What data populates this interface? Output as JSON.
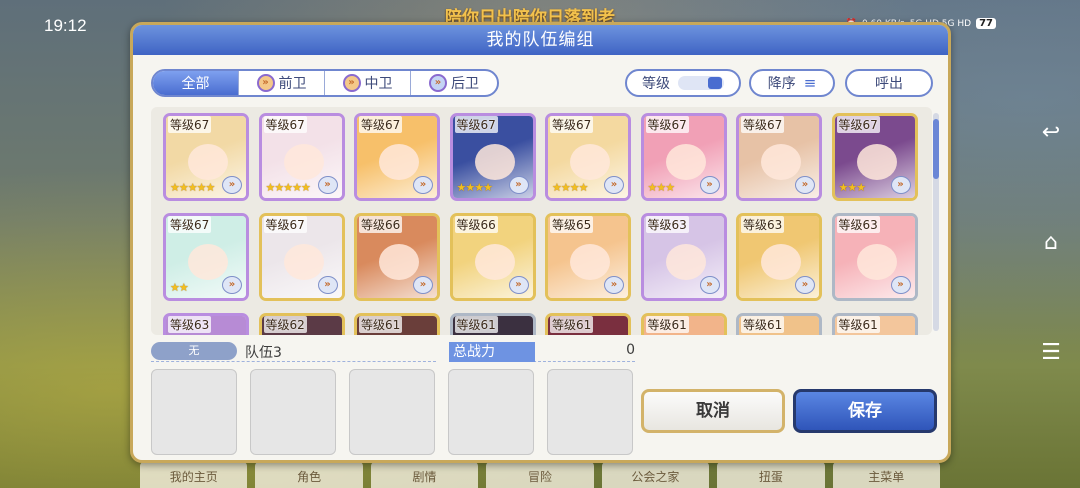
{
  "status": {
    "time": "19:12",
    "marquee": "陪你日出陪你日落到老",
    "net": "0.60 KB/s",
    "signal": "5G HD  5G HD",
    "battery": "77"
  },
  "dialog": {
    "title": "我的队伍编组"
  },
  "tabs": [
    {
      "label": "全部"
    },
    {
      "label": "前卫"
    },
    {
      "label": "中卫"
    },
    {
      "label": "后卫"
    }
  ],
  "controls": {
    "level_label": "等级",
    "sort_label": "降序",
    "call_label": "呼出"
  },
  "characters": [
    {
      "level": "等级67",
      "stars": 5,
      "frame": "purple",
      "color": "#f2d9a5"
    },
    {
      "level": "等级67",
      "stars": 5,
      "frame": "purple",
      "color": "#f3e1e8"
    },
    {
      "level": "等级67",
      "stars": 0,
      "frame": "purple",
      "color": "#f7c06a"
    },
    {
      "level": "等级67",
      "stars": 4,
      "frame": "purple",
      "color": "#3a4fa0"
    },
    {
      "level": "等级67",
      "stars": 4,
      "frame": "purple",
      "color": "#f4d9a0"
    },
    {
      "level": "等级67",
      "stars": 3,
      "frame": "purple",
      "color": "#f1a0b6"
    },
    {
      "level": "等级67",
      "stars": 0,
      "frame": "purple",
      "color": "#e7c2a6"
    },
    {
      "level": "等级67",
      "stars": 3,
      "frame": "gold",
      "color": "#7b4a8e"
    },
    {
      "level": "等级67",
      "stars": 2,
      "frame": "purple",
      "color": "#cfeee6"
    },
    {
      "level": "等级67",
      "stars": 0,
      "frame": "gold",
      "color": "#ece6ea"
    },
    {
      "level": "等级66",
      "stars": 0,
      "frame": "gold",
      "color": "#d98a5d"
    },
    {
      "level": "等级66",
      "stars": 0,
      "frame": "gold",
      "color": "#f2d37e"
    },
    {
      "level": "等级65",
      "stars": 0,
      "frame": "gold",
      "color": "#f5c48e"
    },
    {
      "level": "等级63",
      "stars": 0,
      "frame": "purple",
      "color": "#d6c4e6"
    },
    {
      "level": "等级63",
      "stars": 0,
      "frame": "gold",
      "color": "#f0c772"
    },
    {
      "level": "等级63",
      "stars": 0,
      "frame": "silver",
      "color": "#f6b2b8"
    },
    {
      "level": "等级63",
      "stars": 0,
      "frame": "purple",
      "color": "#b78bd5"
    },
    {
      "level": "等级62",
      "stars": 0,
      "frame": "gold",
      "color": "#5b3a46"
    },
    {
      "level": "等级61",
      "stars": 0,
      "frame": "gold",
      "color": "#6a3e3a"
    },
    {
      "level": "等级61",
      "stars": 0,
      "frame": "silver",
      "color": "#3b3040"
    },
    {
      "level": "等级61",
      "stars": 0,
      "frame": "gold",
      "color": "#7a2f3f"
    },
    {
      "level": "等级61",
      "stars": 0,
      "frame": "gold",
      "color": "#f2b48a"
    },
    {
      "level": "等级61",
      "stars": 0,
      "frame": "silver",
      "color": "#f0c28a"
    },
    {
      "level": "等级61",
      "stars": 0,
      "frame": "silver",
      "color": "#f3c69c"
    }
  ],
  "team": {
    "none_label": "无",
    "name": "队伍3",
    "power_label": "总战力",
    "power_value": "0"
  },
  "buttons": {
    "cancel": "取消",
    "save": "保存"
  },
  "bottom_nav": [
    "我的主页",
    "角色",
    "剧情",
    "冒险",
    "公会之家",
    "扭蛋",
    "主菜单"
  ]
}
